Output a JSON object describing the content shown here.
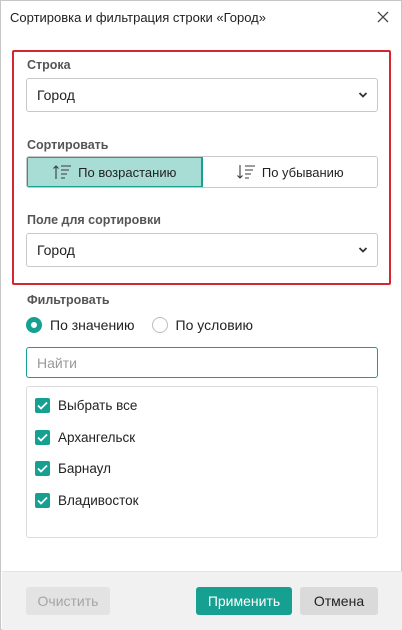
{
  "window": {
    "title": "Сортировка и фильтрация строки «Город»"
  },
  "row": {
    "label": "Строка",
    "selected": "Город"
  },
  "sort": {
    "label": "Сортировать",
    "ascending_label": "По возрастанию",
    "descending_label": "По убыванию",
    "active": "ascending"
  },
  "sort_field": {
    "label": "Поле для сортировки",
    "selected": "Город"
  },
  "filter": {
    "label": "Фильтровать",
    "by_value_label": "По значению",
    "by_condition_label": "По условию",
    "selected_mode": "by_value",
    "search_placeholder": "Найти",
    "items": [
      {
        "label": "Выбрать все",
        "checked": true
      },
      {
        "label": "Архангельск",
        "checked": true
      },
      {
        "label": "Барнаул",
        "checked": true
      },
      {
        "label": "Владивосток",
        "checked": true
      }
    ]
  },
  "footer": {
    "clear_label": "Очистить",
    "apply_label": "Применить",
    "cancel_label": "Отмена"
  },
  "colors": {
    "accent": "#16a091",
    "active_segment": "#a8ddd6",
    "highlight_border": "#d8242c"
  }
}
